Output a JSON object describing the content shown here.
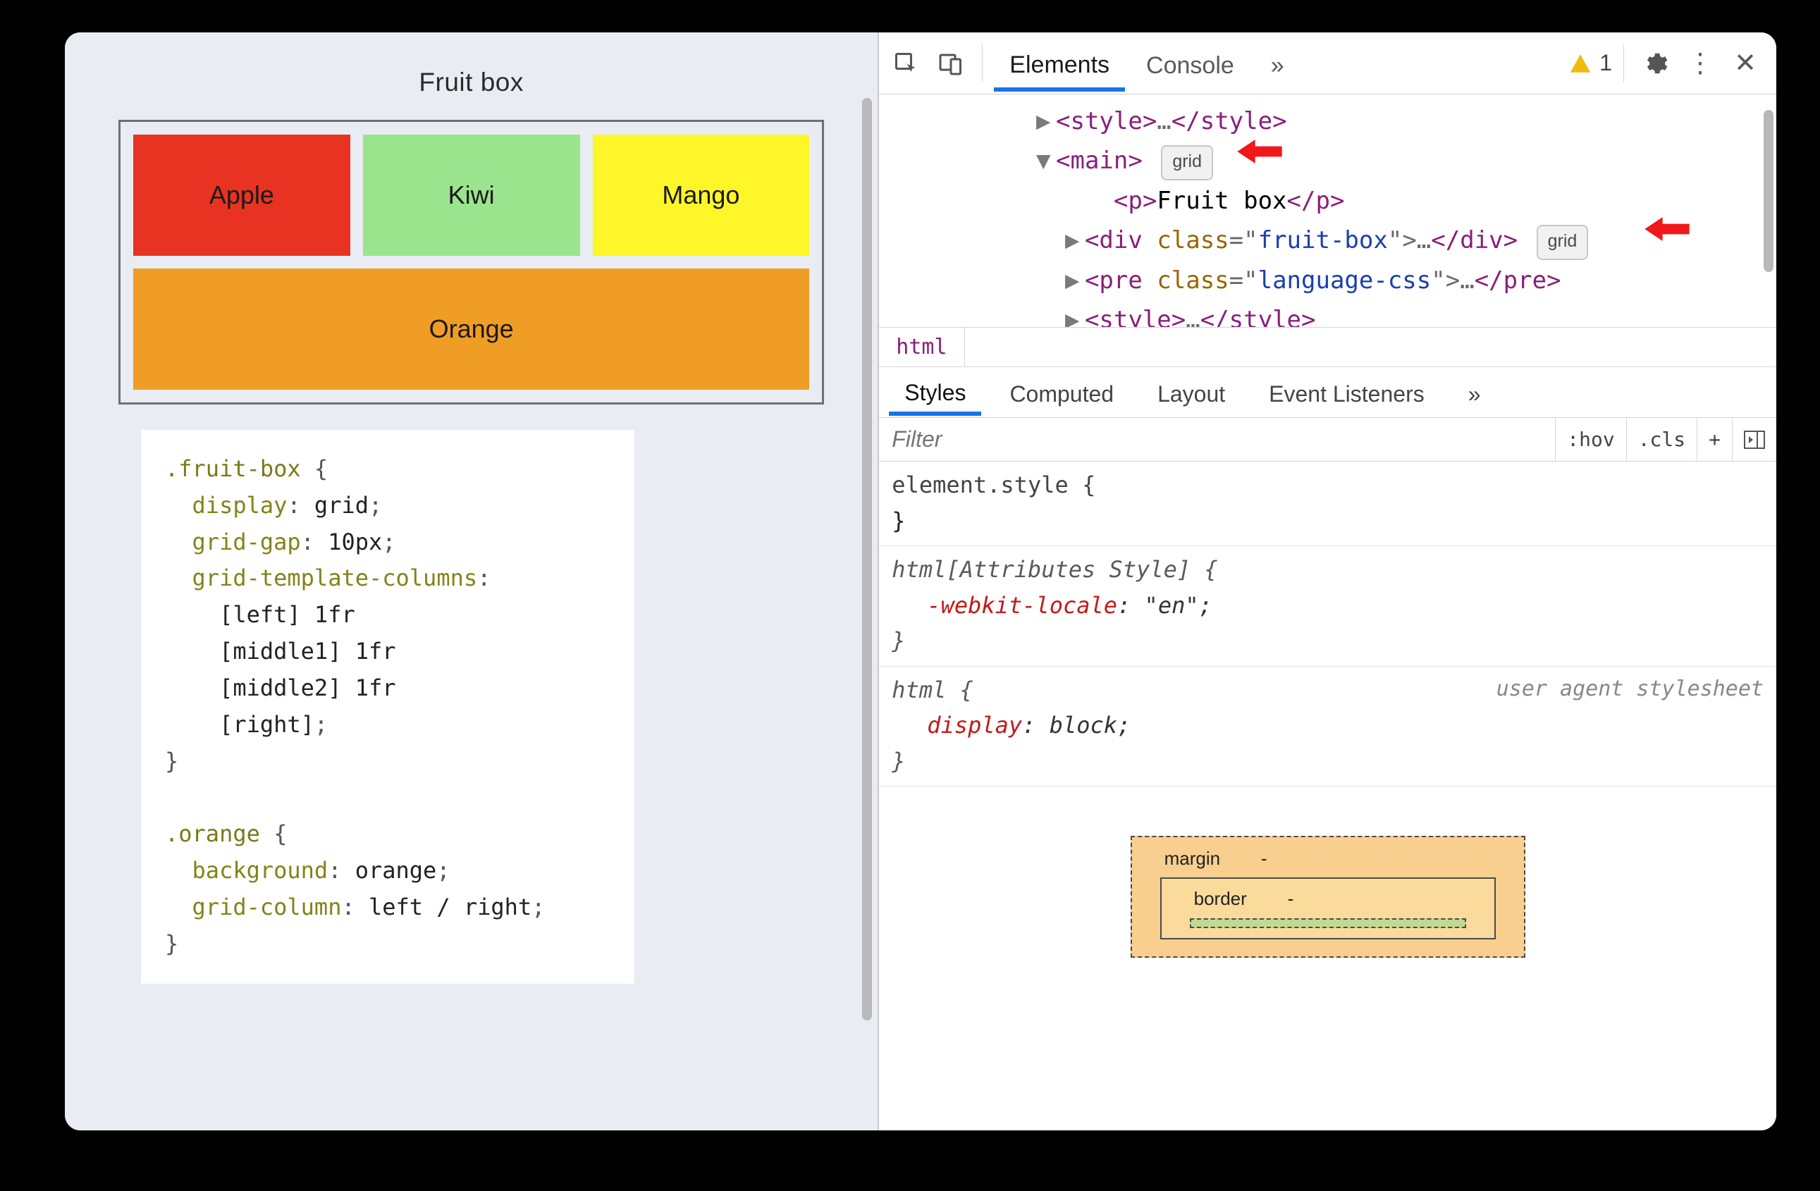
{
  "page": {
    "title": "Fruit box",
    "fruits": {
      "apple": "Apple",
      "kiwi": "Kiwi",
      "mango": "Mango",
      "orange": "Orange"
    },
    "css_code": ".fruit-box {\n  display: grid;\n  grid-gap: 10px;\n  grid-template-columns:\n    [left] 1fr\n    [middle1] 1fr\n    [middle2] 1fr\n    [right];\n}\n\n.orange {\n  background: orange;\n  grid-column: left / right;\n}"
  },
  "devtools": {
    "tabs": {
      "elements": "Elements",
      "console": "Console",
      "more": "»"
    },
    "warning": {
      "count": "1"
    },
    "elements_tree": {
      "style1_open": "<style>",
      "style1_mid": "…",
      "style1_close": "</style>",
      "main_open": "<main>",
      "main_badge": "grid",
      "p_open": "<p>",
      "p_text": "Fruit box",
      "p_close": "</p>",
      "div_open": "<div ",
      "div_attr": "class",
      "div_eq": "=\"",
      "div_val": "fruit-box",
      "div_endq": "\">",
      "div_mid": "…",
      "div_close": "</div>",
      "div_badge": "grid",
      "pre_open": "<pre ",
      "pre_attr": "class",
      "pre_eq": "=\"",
      "pre_val": "language-css",
      "pre_endq": "\">",
      "pre_mid": "…",
      "pre_close": "</pre>",
      "style2_open": "<style>",
      "style2_mid": "…",
      "style2_close": "</style>"
    },
    "breadcrumb": {
      "root": "html"
    },
    "subtabs": {
      "styles": "Styles",
      "computed": "Computed",
      "layout": "Layout",
      "event_listeners": "Event Listeners",
      "more": "»"
    },
    "filter": {
      "placeholder": "Filter",
      "hov": ":hov",
      "cls": ".cls",
      "plus": "+"
    },
    "rules": {
      "r0_sel": "element.style {",
      "r0_close": "}",
      "r1_sel": "html[Attributes Style] {",
      "r1_prop": "-webkit-locale",
      "r1_val": "\"en\"",
      "r1_close": "}",
      "r2_sel": "html {",
      "r2_src": "user agent stylesheet",
      "r2_prop": "display",
      "r2_val": "block",
      "r2_close": "}"
    },
    "boxmodel": {
      "margin_label": "margin",
      "margin_val": "-",
      "border_label": "border",
      "border_val": "-"
    }
  }
}
